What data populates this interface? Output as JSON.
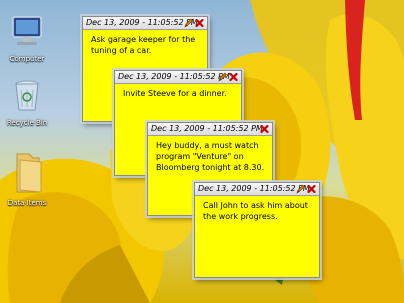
{
  "desktop": {
    "icons": [
      {
        "label": "Computer",
        "icon": "computer-icon"
      },
      {
        "label": "Recycle Bin",
        "icon": "recycle-bin-icon"
      },
      {
        "label": "Data Items",
        "icon": "folder-icon"
      }
    ]
  },
  "notes": [
    {
      "timestamp": "Dec 13, 2009 - 11:05:52 PM",
      "text": "Ask garage keeper for the tuning of a car.",
      "has_edit": true
    },
    {
      "timestamp": "Dec 13, 2009 - 11:05:52 PM",
      "text": "Invite Steeve for a dinner.",
      "has_edit": true
    },
    {
      "timestamp": "Dec 13, 2009 - 11:05:52 PM",
      "text": "Hey buddy, a must watch program \"Venture\" on Bloomberg tonight at 8.30.",
      "has_edit": false
    },
    {
      "timestamp": "Dec 13, 2009 - 11:05:52 PM",
      "text": "Call John to ask him about the work progress.",
      "has_edit": true
    }
  ],
  "colors": {
    "note_bg": "#ffff00",
    "close_red": "#cc0000",
    "edit_orange": "#e07b00"
  }
}
